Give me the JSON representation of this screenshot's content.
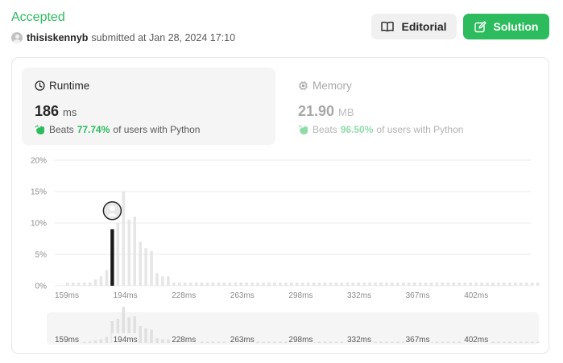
{
  "submission": {
    "status": "Accepted",
    "username": "thisiskennyb",
    "submitted_text": "submitted at Jan 28, 2024 17:10"
  },
  "buttons": {
    "editorial_label": "Editorial",
    "solution_label": "Solution"
  },
  "runtime": {
    "title": "Runtime",
    "value": "186",
    "unit": "ms",
    "beats_prefix": "Beats",
    "beats_pct": "77.74%",
    "beats_suffix": "of users with Python"
  },
  "memory": {
    "title": "Memory",
    "value": "21.90",
    "unit": "MB",
    "beats_prefix": "Beats",
    "beats_pct": "96.50%",
    "beats_suffix": "of users with Python"
  },
  "colors": {
    "accent_green": "#2cbb5d",
    "highlight_bar": "#1a1a1a",
    "bar": "#e6e6e6"
  },
  "chart_data": {
    "type": "bar",
    "title": "",
    "xlabel": "",
    "ylabel": "",
    "y_tick_labels": [
      "0%",
      "5%",
      "10%",
      "15%",
      "20%"
    ],
    "ylim": [
      0,
      20
    ],
    "x_tick_labels": [
      "159ms",
      "194ms",
      "228ms",
      "263ms",
      "298ms",
      "332ms",
      "367ms",
      "402ms"
    ],
    "grid": true,
    "highlight_index": 8,
    "values": [
      0.5,
      0.5,
      0.5,
      0.5,
      0.5,
      1.0,
      1.5,
      2.5,
      9.0,
      10.0,
      15.0,
      10.5,
      11.0,
      7.0,
      6.0,
      5.5,
      2.0,
      1.5,
      1.5,
      0.5,
      0.5,
      0.5,
      0.5,
      0.5,
      0.5,
      0.5,
      0.5,
      0.5,
      0.5,
      0.5,
      0.5,
      0.5,
      0.5,
      0.5,
      0.5,
      0.5,
      0.5,
      0.5,
      0.5,
      0.5,
      0.5,
      0.5,
      0.5,
      0.5,
      0.5,
      0.5,
      0.5,
      0.5,
      0.5,
      0.5,
      0.5,
      0.5,
      0.5,
      0.5,
      0.5,
      0.5,
      0.5,
      0.5,
      0.5,
      0.5,
      0.5,
      0.5,
      0.5,
      0.5,
      0.5,
      0.5,
      0.5,
      0.5,
      0.5,
      0.5,
      0.5,
      0.5,
      0.5,
      0.5,
      0.5,
      0.5,
      0.5,
      0.5,
      0.5,
      0.5,
      0.5,
      0.5,
      0.5,
      0.5,
      0.5
    ]
  }
}
